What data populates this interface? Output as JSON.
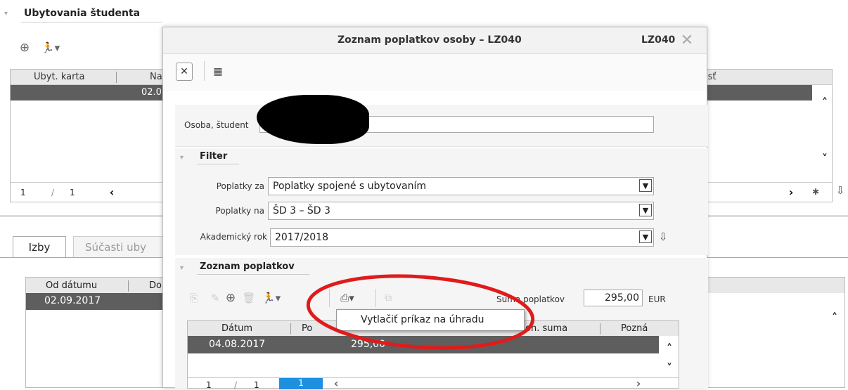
{
  "bg": {
    "section_title": "Ubytovania študenta",
    "toolbar_arrow": "▾",
    "columns": [
      "Ubyt. karta",
      "Na",
      "losť"
    ],
    "selected_cell": "02.0",
    "pager": {
      "page": "1",
      "sep": "/",
      "total": "1"
    },
    "tabs": [
      "Izby",
      "Súčasti uby"
    ],
    "dates_columns": [
      "Od dátumu",
      "Do"
    ],
    "dates_value": "02.09.2017"
  },
  "dialog": {
    "title": "Zoznam poplatkov osoby – LZ040",
    "code": "LZ040",
    "person_label": "Osoba, študent",
    "filter_title": "Filter",
    "filter": {
      "poplatky_za_label": "Poplatky za",
      "poplatky_za_value": "Poplatky spojené s ubytovaním",
      "poplatky_na_label": "Poplatky na",
      "poplatky_na_value": "ŠD 3 – ŠD 3",
      "rok_label": "Akademický rok",
      "rok_value": "2017/2018"
    },
    "list_title": "Zoznam poplatkov",
    "suma_label": "Suma poplatkov",
    "suma_value": "295,00",
    "currency": "EUR",
    "menu_item": "Vytlačiť príkaz na úhradu",
    "columns": [
      "Dátum",
      "Po",
      "on. suma",
      "Pozná"
    ],
    "row": {
      "date": "04.08.2017",
      "amount": "295,00"
    },
    "pager": {
      "page": "1",
      "sep": "/",
      "total": "1",
      "current": "1"
    }
  },
  "colors": {
    "highlight_red": "#e01b1b",
    "selected_row": "#5e5e5e",
    "pager_blue": "#1e90e0"
  }
}
